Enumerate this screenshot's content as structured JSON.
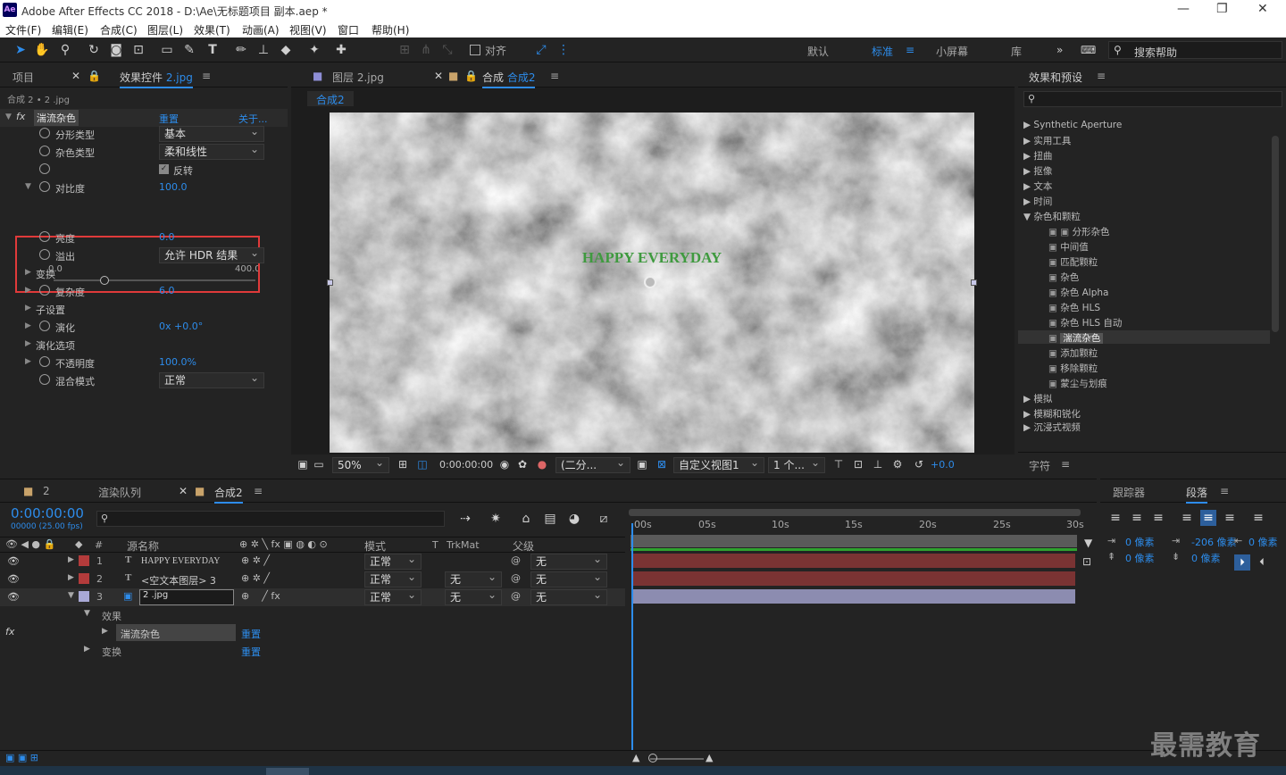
{
  "app": {
    "title": "Adobe After Effects CC 2018 - D:\\Ae\\无标题项目 副本.aep *",
    "logo": "Ae"
  },
  "menu": [
    "文件(F)",
    "编辑(E)",
    "合成(C)",
    "图层(L)",
    "效果(T)",
    "动画(A)",
    "视图(V)",
    "窗口",
    "帮助(H)"
  ],
  "toolbar": {
    "align_label": "对齐",
    "workspaces": [
      "默认",
      "标准",
      "小屏幕",
      "库"
    ],
    "active_workspace": "标准",
    "search_help_placeholder": "搜索帮助"
  },
  "left_panel": {
    "tab_project": "项目",
    "tab_effect_controls_prefix": "效果控件",
    "tab_effect_controls_file": "2.jpg",
    "breadcrumb": "合成 2 • 2 .jpg",
    "effect_name": "湍流杂色",
    "reset_label": "重置",
    "about_label": "关于...",
    "props": [
      {
        "label": "分形类型",
        "value": "基本"
      },
      {
        "label": "杂色类型",
        "value": "柔和线性"
      },
      {
        "label": "",
        "value": "反转"
      },
      {
        "label": "对比度",
        "value": "100.0"
      },
      {
        "label": "亮度",
        "value": "0.0"
      },
      {
        "label": "溢出",
        "value": "允许 HDR 结果"
      },
      {
        "label": "变换",
        "value": ""
      },
      {
        "label": "复杂度",
        "value": "6.0"
      },
      {
        "label": "子设置",
        "value": ""
      },
      {
        "label": "演化",
        "value": "0x +0.0°"
      },
      {
        "label": "演化选项",
        "value": ""
      },
      {
        "label": "不透明度",
        "value": "100.0%"
      },
      {
        "label": "混合模式",
        "value": "正常"
      }
    ],
    "slider_min": "0.0",
    "slider_max": "400.0",
    "contrast_fraction": 0.25
  },
  "viewer": {
    "tab_layer": "图层 2.jpg",
    "tab_comp_prefix": "合成",
    "tab_comp_name": "合成2",
    "comp_chip": "合成2",
    "overlay_text": "HAPPY EVERYDAY",
    "bottom": {
      "zoom": "50%",
      "timecode": "0:00:00:00",
      "resolution": "(二分...",
      "view": "自定义视图1",
      "views_count": "1 个...",
      "exposure": "+0.0"
    }
  },
  "effects_presets": {
    "title": "效果和预设",
    "items": [
      "Synthetic Aperture",
      "实用工具",
      "扭曲",
      "抠像",
      "文本",
      "时间",
      "杂色和颗粒",
      "分形杂色",
      "中间值",
      "匹配颗粒",
      "杂色",
      "杂色 Alpha",
      "杂色 HLS",
      "杂色 HLS 自动",
      "湍流杂色",
      "添加颗粒",
      "移除颗粒",
      "蒙尘与划痕",
      "模拟",
      "模糊和锐化",
      "沉浸式视频"
    ],
    "character_label": "字符"
  },
  "timeline": {
    "tab_2": "2",
    "tab_render": "渲染队列",
    "tab_comp": "合成2",
    "timecode": "0:00:00:00",
    "fps": "00000 (25.00 fps)",
    "col_source": "源名称",
    "col_mode": "模式",
    "col_t": "T",
    "col_trkmat": "TrkMat",
    "col_parent": "父级",
    "layers": [
      {
        "num": "1",
        "type": "T",
        "name": "HAPPY EVERYDAY",
        "mode": "正常",
        "trkmat": "",
        "parent": "无",
        "color": "#b33b3b"
      },
      {
        "num": "2",
        "type": "T",
        "name": "<空文本图层> 3",
        "mode": "正常",
        "trkmat": "无",
        "parent": "无",
        "color": "#b33b3b"
      },
      {
        "num": "3",
        "type": "img",
        "name": "2 .jpg",
        "mode": "正常",
        "trkmat": "无",
        "parent": "无",
        "color": "#a9a9d6"
      }
    ],
    "sub_effects": "效果",
    "sub_effect_name": "湍流杂色",
    "sub_reset": "重置",
    "sub_transform": "变换",
    "sub_reset2": "重置",
    "ruler": [
      "00s",
      "05s",
      "10s",
      "15s",
      "20s",
      "25s",
      "30s"
    ]
  },
  "right_bottom": {
    "tab_tracker": "跟踪器",
    "tab_paragraph": "段落",
    "indent_left": "0 像素",
    "indent_first": "-206 像素",
    "indent_right": "0 像素",
    "space_before": "0 像素",
    "space_after": "0 像素"
  },
  "watermark": "最需教育",
  "colors": {
    "accent": "#2d8ceb",
    "highlight_box": "#e03a3a"
  }
}
